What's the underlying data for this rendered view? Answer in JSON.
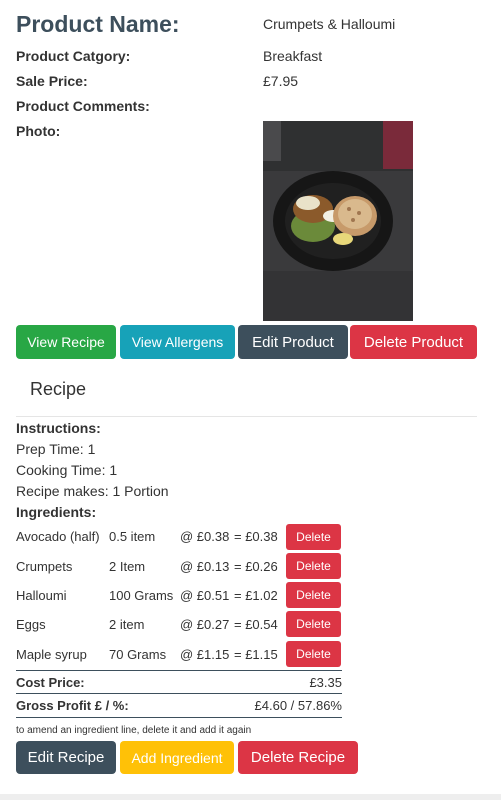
{
  "product": {
    "name_label": "Product Name:",
    "name_value": "Crumpets & Halloumi",
    "category_label": "Product Catgory:",
    "category_value": "Breakfast",
    "price_label": "Sale Price:",
    "price_value": "£7.95",
    "comments_label": "Product Comments:",
    "photo_label": "Photo:"
  },
  "product_buttons": {
    "view_recipe": "View Recipe",
    "view_allergens": "View Allergens",
    "edit_product": "Edit Product",
    "delete_product": "Delete Product"
  },
  "recipe": {
    "heading": "Recipe",
    "instructions_label": "Instructions:",
    "prep_time": "Prep Time: 1",
    "cooking_time": "Cooking Time: 1",
    "makes": "Recipe makes: 1 Portion",
    "ingredients_label": "Ingredients:",
    "ingredients": [
      {
        "name": "Avocado (half)",
        "qty": "0.5 item",
        "unit_price": "@ £0.38",
        "total": "= £0.38",
        "delete_label": "Delete"
      },
      {
        "name": "Crumpets",
        "qty": "2 Item",
        "unit_price": "@ £0.13",
        "total": "= £0.26",
        "delete_label": "Delete"
      },
      {
        "name": "Halloumi",
        "qty": "100 Grams",
        "unit_price": "@ £0.51",
        "total": "= £1.02",
        "delete_label": "Delete"
      },
      {
        "name": "Eggs",
        "qty": "2 item",
        "unit_price": "@ £0.27",
        "total": "= £0.54",
        "delete_label": "Delete"
      },
      {
        "name": "Maple syrup",
        "qty": "70 Grams",
        "unit_price": "@ £1.15",
        "total": "= £1.15",
        "delete_label": "Delete"
      }
    ],
    "cost_label": "Cost Price:",
    "cost_value": "£3.35",
    "gross_label": "Gross Profit £ / %:",
    "gross_value": "£4.60 / 57.86%",
    "note": "to amend an ingredient line, delete it and add it again"
  },
  "recipe_buttons": {
    "edit_recipe": "Edit Recipe",
    "add_ingredient": "Add Ingredient",
    "delete_recipe": "Delete Recipe"
  },
  "colors": {
    "success": "#28a745",
    "info": "#17a2b8",
    "dark": "#3d4f5c",
    "danger": "#dc3545",
    "warning": "#ffc107"
  }
}
